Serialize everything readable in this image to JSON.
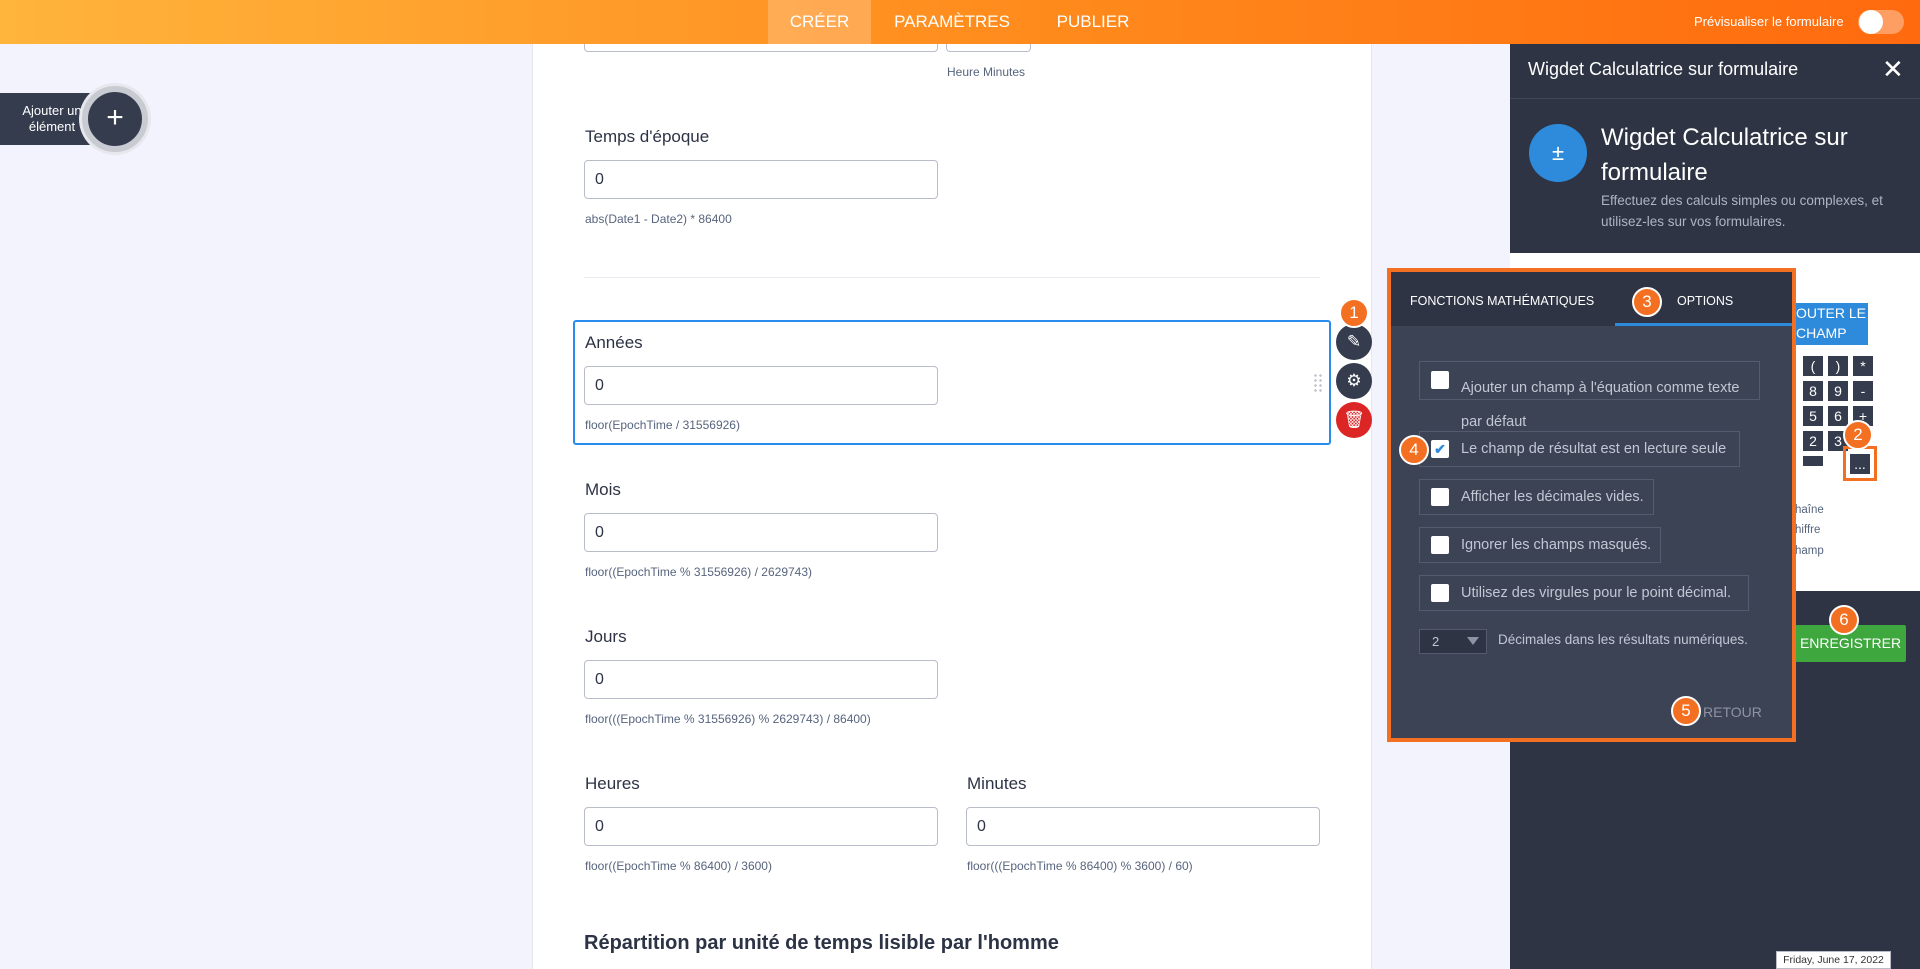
{
  "topbar": {
    "tabs": [
      {
        "label": "CRÉER",
        "active": true
      },
      {
        "label": "PARAMÈTRES",
        "active": false
      },
      {
        "label": "PUBLIER",
        "active": false
      }
    ],
    "preview_label": "Prévisualiser le formulaire",
    "preview_toggle_on": false
  },
  "add_element": {
    "label": "Ajouter un élément",
    "icon": "plus-icon"
  },
  "form": {
    "top_sub": "Heure Minutes",
    "fields": {
      "epoch": {
        "label": "Temps d'époque",
        "value": "0",
        "formula": "abs(Date1 - Date2) * 86400"
      },
      "years": {
        "label": "Années",
        "value": "0",
        "formula": "floor(EpochTime / 31556926)"
      },
      "months": {
        "label": "Mois",
        "value": "0",
        "formula": "floor((EpochTime % 31556926) / 2629743)"
      },
      "days": {
        "label": "Jours",
        "value": "0",
        "formula": "floor(((EpochTime % 31556926) % 2629743) / 86400)"
      },
      "hours": {
        "label": "Heures",
        "value": "0",
        "formula": "floor((EpochTime % 86400) / 3600)"
      },
      "minutes": {
        "label": "Minutes",
        "value": "0",
        "formula": "floor(((EpochTime % 86400) % 3600) / 60)"
      }
    },
    "section_title": "Répartition par unité de temps lisible par l'homme"
  },
  "right_panel": {
    "header": "Wigdet Calculatrice sur formulaire",
    "widget_title": "Wigdet Calculatrice sur formulaire",
    "widget_desc": "Effectuez des calculs simples ou complexes, et utilisez-les sur vos formulaires.",
    "add_field_label": "OUTER LE CHAMP",
    "keys": [
      "(",
      ")",
      "*",
      "8",
      "9",
      "-",
      "5",
      "6",
      "+",
      "2",
      "3",
      "...",
      ""
    ],
    "hint_lines": [
      "haîne",
      "hiffre",
      "hamp"
    ],
    "save_label": "ENREGISTRER"
  },
  "modal": {
    "tabs": [
      "FONCTIONS MATHÉMATIQUES",
      "OPTIONS"
    ],
    "active_tab": "OPTIONS",
    "options": [
      {
        "label": "Ajouter un champ à l'équation comme texte par défaut",
        "checked": false
      },
      {
        "label": "Le champ de résultat est en lecture seule",
        "checked": true
      },
      {
        "label": "Afficher les décimales vides.",
        "checked": false
      },
      {
        "label": "Ignorer les champs masqués.",
        "checked": false
      },
      {
        "label": "Utilisez des virgules pour le point décimal.",
        "checked": false
      }
    ],
    "decimals_value": "2",
    "decimals_label": "Décimales dans les résultats numériques.",
    "back_label": "RETOUR"
  },
  "markers": [
    "1",
    "2",
    "3",
    "4",
    "5",
    "6"
  ],
  "date_badge": "Friday, June 17, 2022",
  "colors": {
    "accent": "#f36f22",
    "topbar": "#ff8a1c",
    "primary": "#2e8bdc",
    "panel": "#2e3444",
    "save": "#3ea83e",
    "delete": "#dc2626"
  }
}
